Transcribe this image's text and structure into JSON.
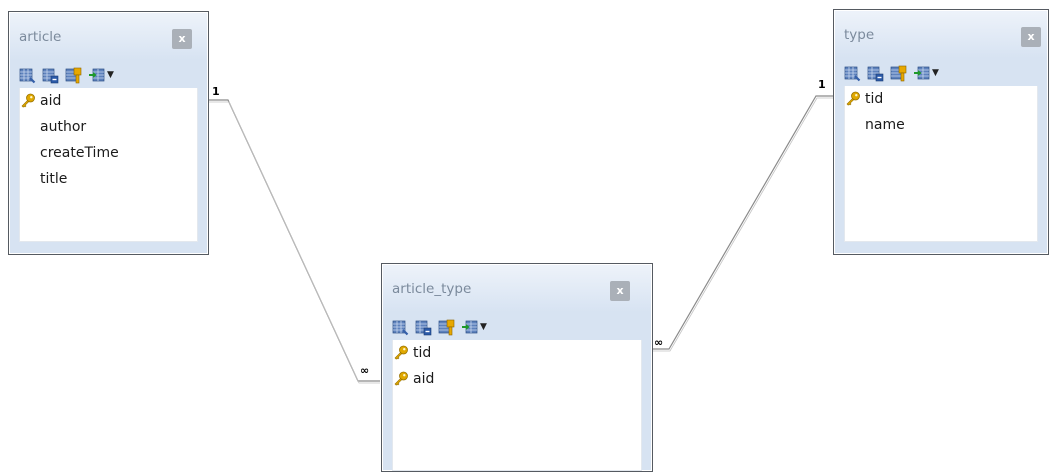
{
  "tables": {
    "article": {
      "name": "article",
      "fields": [
        {
          "name": "aid",
          "primary_key": true
        },
        {
          "name": "author",
          "primary_key": false
        },
        {
          "name": "createTime",
          "primary_key": false
        },
        {
          "name": "title",
          "primary_key": false
        }
      ]
    },
    "type": {
      "name": "type",
      "fields": [
        {
          "name": "tid",
          "primary_key": true
        },
        {
          "name": "name",
          "primary_key": false
        }
      ]
    },
    "article_type": {
      "name": "article_type",
      "fields": [
        {
          "name": "tid",
          "primary_key": true
        },
        {
          "name": "aid",
          "primary_key": true
        }
      ]
    }
  },
  "close_label": "x",
  "toolbar_icons": [
    "add-field-icon",
    "remove-field-icon",
    "primary-key-icon",
    "insert-field-icon"
  ],
  "relations": [
    {
      "from": "article",
      "from_cardinality": "1",
      "to": "article_type",
      "to_cardinality": "∞"
    },
    {
      "from": "type",
      "from_cardinality": "1",
      "to": "article_type",
      "to_cardinality": "∞"
    }
  ],
  "colors": {
    "table_border": "#555a61",
    "header_gradient_top": "#eef3fa",
    "header_gradient_bottom": "#d7e3f2",
    "title_text": "#7b8a9c",
    "relation_line": "#8a8a8a",
    "key_icon": "#e0a800"
  }
}
